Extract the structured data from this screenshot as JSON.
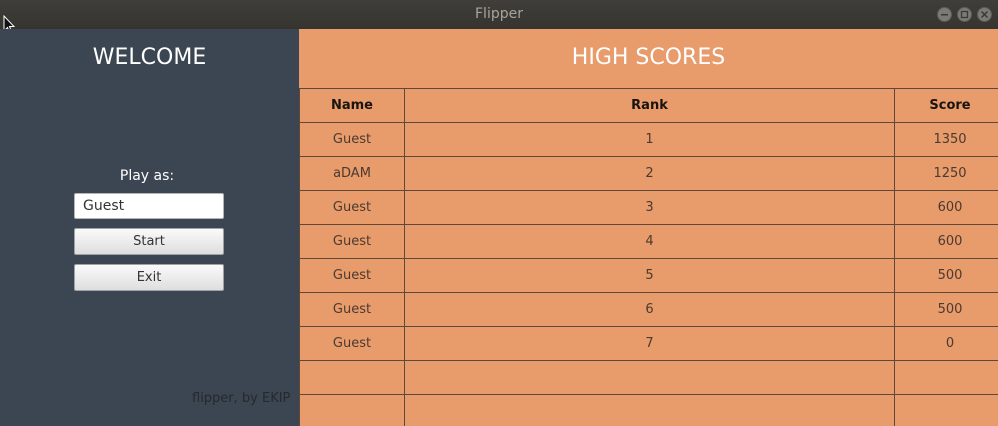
{
  "window": {
    "title": "Flipper"
  },
  "left": {
    "welcome": "WELCOME",
    "play_as_label": "Play as:",
    "name_value": "Guest",
    "start_label": "Start",
    "exit_label": "Exit",
    "credit": "flipper, by EKIP"
  },
  "scores": {
    "title": "HIGH SCORES",
    "headers": [
      "Name",
      "Rank",
      "Score"
    ],
    "rows": [
      [
        "Guest",
        "1",
        "1350"
      ],
      [
        "aDAM",
        "2",
        "1250"
      ],
      [
        "Guest",
        "3",
        "600"
      ],
      [
        "Guest",
        "4",
        "600"
      ],
      [
        "Guest",
        "5",
        "500"
      ],
      [
        "Guest",
        "6",
        "500"
      ],
      [
        "Guest",
        "7",
        "0"
      ],
      [
        "",
        "",
        ""
      ],
      [
        "",
        "",
        ""
      ]
    ]
  },
  "colors": {
    "left_panel": "#3b4652",
    "right_panel": "#e89b6b",
    "titlebar": "#3c3b37"
  }
}
